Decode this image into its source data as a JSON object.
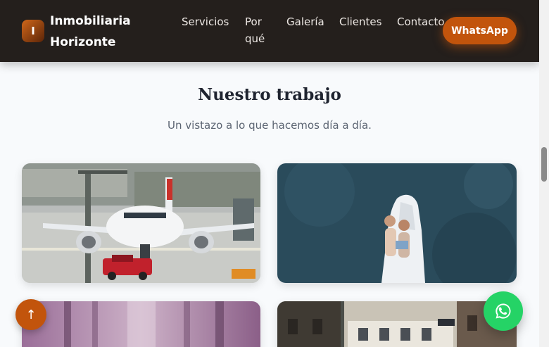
{
  "header": {
    "logo_letter": "I",
    "brand_name": "Inmobiliaria Horizonte",
    "nav": {
      "servicios": "Servicios",
      "porque": "Por qué",
      "galeria": "Galería",
      "clientes": "Clientes",
      "contacto": "Contacto"
    },
    "whatsapp_label": "WhatsApp"
  },
  "section": {
    "title": "Nuestro trabajo",
    "subtitle": "Un vistazo a lo que hacemos día a día."
  },
  "floating": {
    "scroll_top_icon": "arrow-up-icon",
    "scroll_top_glyph": "↑",
    "whatsapp_icon": "whatsapp-icon"
  },
  "colors": {
    "header_bg": "#241f1c",
    "accent": "#c2540c",
    "whatsapp_green": "#25d366",
    "page_bg": "#f8fafc"
  }
}
